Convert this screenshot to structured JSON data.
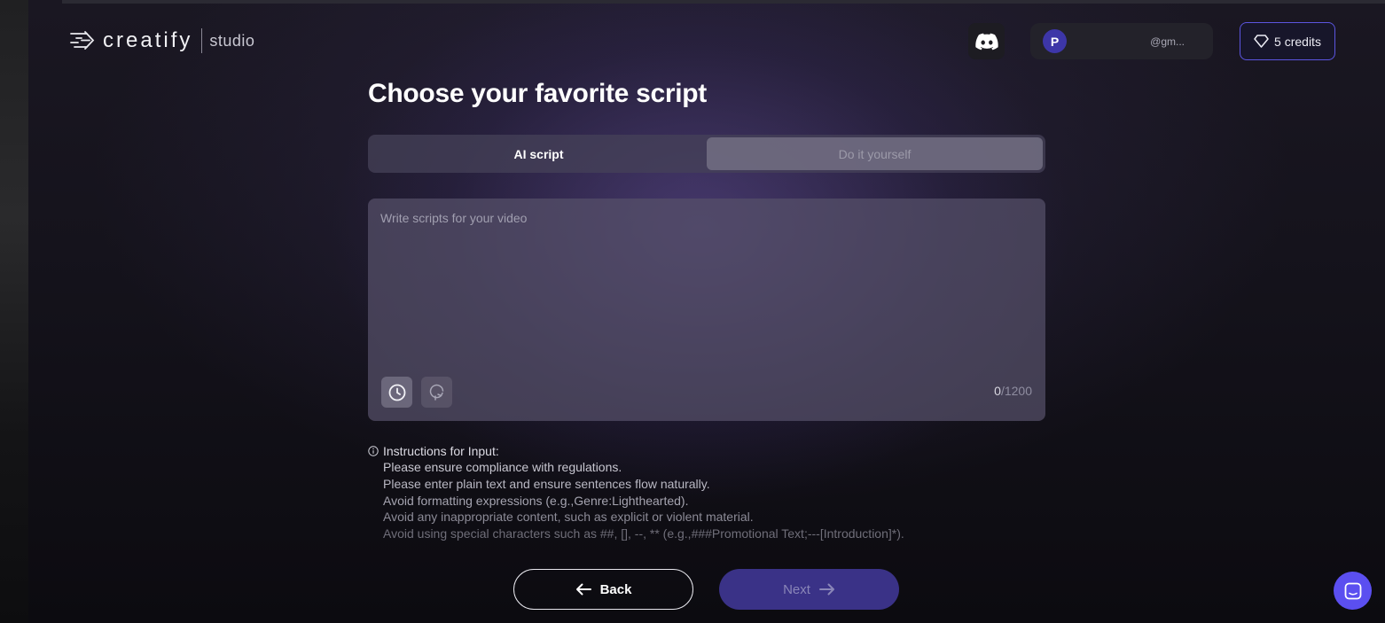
{
  "header": {
    "logo_text": "creatify",
    "logo_sub": "studio",
    "discord_icon": "discord-icon",
    "user": {
      "avatar_letter": "P",
      "email": "@gm..."
    },
    "credits_label": "5 credits",
    "credits_icon": "diamond-icon"
  },
  "main": {
    "title": "Choose your favorite script",
    "tabs": [
      {
        "label": "AI script",
        "active": false
      },
      {
        "label": "Do it yourself",
        "active": true
      }
    ],
    "editor": {
      "placeholder": "Write scripts for your video",
      "value": "",
      "count": "0",
      "limit": "/1200",
      "tools": [
        "history-icon",
        "refresh-icon"
      ]
    },
    "instructions": {
      "heading": "Instructions for Input:",
      "lines": [
        "Please ensure compliance with regulations.",
        "Please enter plain text and ensure sentences flow naturally.",
        "Avoid formatting expressions (e.g.,Genre:Lighthearted).",
        "Avoid any inappropriate content, such as explicit or violent material.",
        "Avoid using special characters such as ##, [], --, ** (e.g.,###Promotional Text;---[Introduction]*)."
      ]
    }
  },
  "footer": {
    "back_label": "Back",
    "next_label": "Next"
  },
  "colors": {
    "accent": "#5b55e0",
    "next_button": "#3a3287",
    "chat_button": "#5b4ff0"
  }
}
